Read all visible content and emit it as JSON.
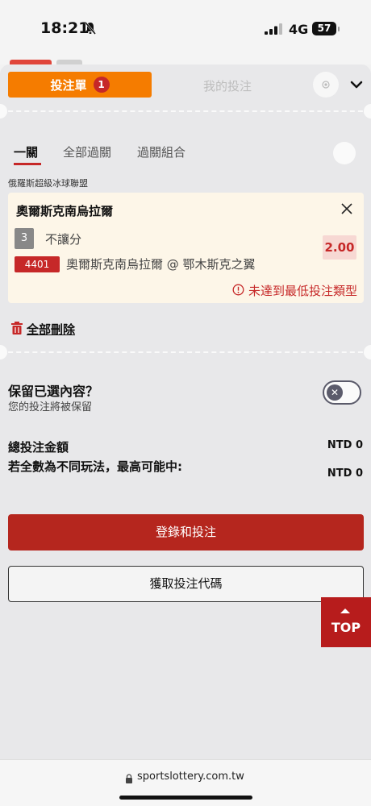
{
  "status_bar": {
    "time": "18:21",
    "network": "4G",
    "battery": "57"
  },
  "tabs": {
    "betslip_label": "投注單",
    "betslip_count": "1",
    "mybets_label": "我的投注"
  },
  "bet_types": [
    "一關",
    "全部過關",
    "過關組合"
  ],
  "league": "俄羅斯超級冰球聯盟",
  "selection": {
    "title": "奧爾斯克南烏拉爾",
    "market_no": "3",
    "market": "不讓分",
    "odds": "2.00",
    "match_code": "4401",
    "match": "奧爾斯克南烏拉爾 @ 鄂木斯克之翼",
    "warning": "未達到最低投注類型"
  },
  "delete_all": "全部刪除",
  "keep": {
    "title": "保留已選內容？",
    "subtitle": "您的投注將被保留"
  },
  "totals": {
    "stake_label": "總投注金額",
    "stake_value": "NTD 0",
    "max_label": "若全數為不同玩法，最高可能中:",
    "max_value": "NTD 0"
  },
  "buttons": {
    "login_bet": "登錄和投注",
    "get_code": "獲取投注代碼",
    "top": "TOP"
  },
  "browser": {
    "url": "sportslottery.com.tw"
  },
  "colors": {
    "accent": "#f57c00",
    "brand_red": "#b5261e",
    "badge_red": "#c62828"
  }
}
